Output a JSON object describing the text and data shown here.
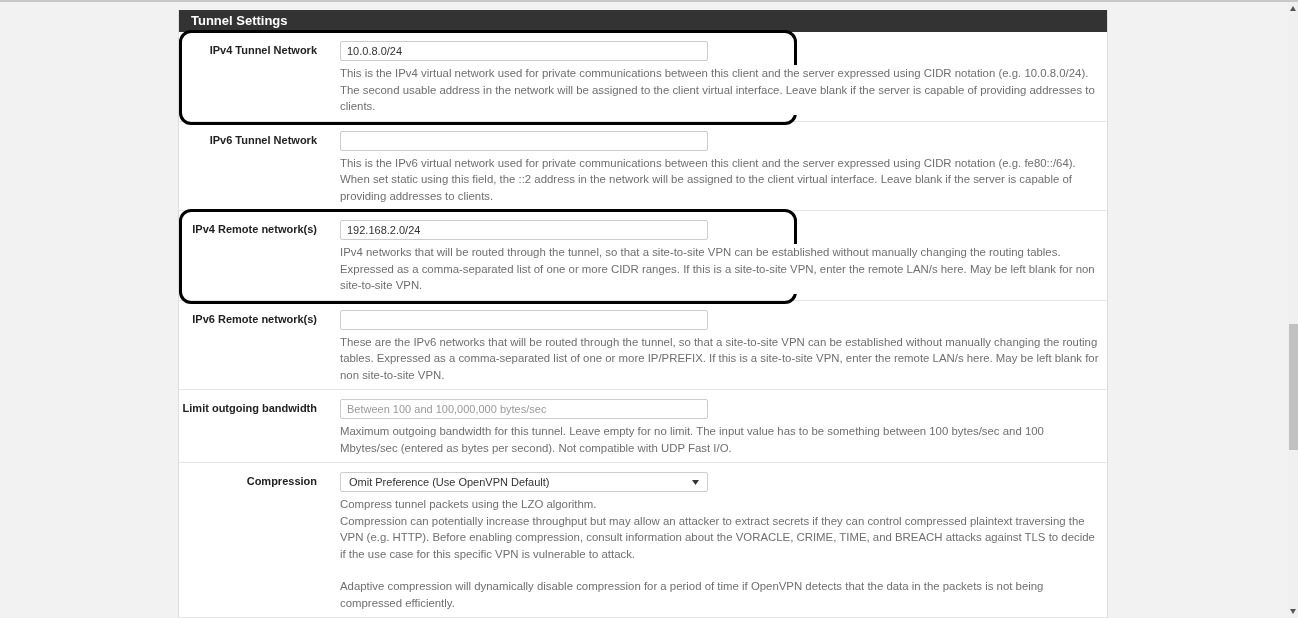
{
  "panel": {
    "title": "Tunnel Settings"
  },
  "rows": [
    {
      "label": "IPv4 Tunnel Network",
      "kind": "text",
      "value": "10.0.8.0/24",
      "highlighted": true,
      "description": [
        [
          "This is the IPv4 virtual network used for private communications between this client and the server expressed using CIDR notation (e.g. 10.0.8.0/24). The second usable address in the network will be assigned to the client virtual interface. Leave blank if the server is capable of providing addresses to clients."
        ]
      ]
    },
    {
      "label": "IPv6 Tunnel Network",
      "kind": "text",
      "value": "",
      "highlighted": false,
      "description": [
        [
          "This is the IPv6 virtual network used for private communications between this client and the server expressed using CIDR notation (e.g. fe80::/64). When set static using this field, the ::2 address in the network will be assigned to the client virtual interface. Leave blank if the server is capable of providing addresses to clients."
        ]
      ]
    },
    {
      "label": "IPv4 Remote network(s)",
      "kind": "text",
      "value": "192.168.2.0/24",
      "highlighted": true,
      "description": [
        [
          "IPv4 networks that will be routed through the tunnel, so that a site-to-site VPN can be established without manually changing the routing tables. Expressed as a comma-separated list of one or more CIDR ranges. If this is a site-to-site VPN, enter the remote LAN/s here. May be left blank for non site-to-site VPN."
        ]
      ]
    },
    {
      "label": "IPv6 Remote network(s)",
      "kind": "text",
      "value": "",
      "highlighted": false,
      "description": [
        [
          "These are the IPv6 networks that will be routed through the tunnel, so that a site-to-site VPN can be established without manually changing the routing tables. Expressed as a comma-separated list of one or more IP/PREFIX. If this is a site-to-site VPN, enter the remote LAN/s here. May be left blank for non site-to-site VPN."
        ]
      ]
    },
    {
      "label": "Limit outgoing bandwidth",
      "kind": "text",
      "placeholder": "Between 100 and 100,000,000 bytes/sec",
      "highlighted": false,
      "description": [
        [
          "Maximum outgoing bandwidth for this tunnel. Leave empty for no limit. The input value has to be something between 100 bytes/sec and 100 Mbytes/sec (entered as bytes per second). Not compatible with UDP Fast I/O."
        ]
      ]
    },
    {
      "label": "Compression",
      "kind": "select",
      "value": "Omit Preference (Use OpenVPN Default)",
      "highlighted": false,
      "description": [
        [
          "Compress tunnel packets using the LZO algorithm.",
          "Compression can potentially increase throughput but may allow an attacker to extract secrets if they can control compressed plaintext traversing the VPN (e.g. HTTP). Before enabling compression, consult information about the VORACLE, CRIME, TIME, and BREACH attacks against TLS to decide if the use case for this specific VPN is vulnerable to attack."
        ],
        [
          "Adaptive compression will dynamically disable compression for a period of time if OpenVPN detects that the data in the packets is not being compressed efficiently."
        ]
      ]
    }
  ]
}
